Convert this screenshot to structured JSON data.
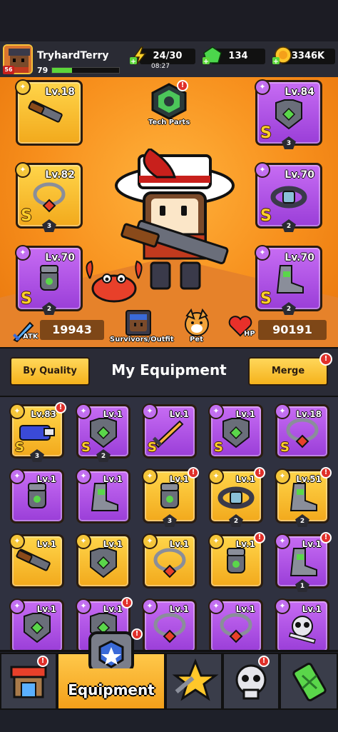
{
  "player": {
    "name": "TryhardTerry",
    "avatar_level": "56",
    "level": "79",
    "xp_fraction": 0.3
  },
  "resources": {
    "energy": "24/30",
    "energy_timer": "08:27",
    "gems": "134",
    "gold": "3346K"
  },
  "hero": {
    "tech_parts_label": "Tech Parts",
    "slots": [
      {
        "name": "weapon",
        "level": "Lv.18",
        "rarity": "",
        "stars": "",
        "quality": "gold",
        "icon": "shotgun-icon"
      },
      {
        "name": "armor",
        "level": "Lv.84",
        "rarity": "S",
        "stars": "3",
        "quality": "purple",
        "icon": "armor-icon"
      },
      {
        "name": "necklace",
        "level": "Lv.82",
        "rarity": "S",
        "stars": "3",
        "quality": "gold",
        "icon": "necklace-icon"
      },
      {
        "name": "belt",
        "level": "Lv.70",
        "rarity": "S",
        "stars": "2",
        "quality": "purple",
        "icon": "belt-icon"
      },
      {
        "name": "gloves",
        "level": "Lv.70",
        "rarity": "S",
        "stars": "2",
        "quality": "purple",
        "icon": "gloves-icon"
      },
      {
        "name": "boots",
        "level": "Lv.70",
        "rarity": "S",
        "stars": "2",
        "quality": "purple",
        "icon": "boots-icon"
      }
    ],
    "atk_label": "ATK",
    "atk_value": "19943",
    "hp_label": "HP",
    "hp_value": "90191",
    "survivors_label": "Survivors/Outfit",
    "pet_label": "Pet"
  },
  "equipment": {
    "by_quality_label": "By Quality",
    "title": "My Equipment",
    "merge_label": "Merge",
    "merge_badge": "!",
    "items": [
      {
        "level": "Lv.83",
        "rarity": "S",
        "stars": "3",
        "quality": "gold",
        "icon": "blaster-icon",
        "badge": true
      },
      {
        "level": "Lv.1",
        "rarity": "S",
        "stars": "2",
        "quality": "purple",
        "icon": "armor-icon",
        "badge": false
      },
      {
        "level": "Lv.1",
        "rarity": "S",
        "stars": "",
        "quality": "purple",
        "icon": "sword-icon",
        "badge": false
      },
      {
        "level": "Lv.1",
        "rarity": "S",
        "stars": "",
        "quality": "purple",
        "icon": "armor-icon",
        "badge": false
      },
      {
        "level": "Lv.18",
        "rarity": "S",
        "stars": "",
        "quality": "purple",
        "icon": "necklace-icon",
        "badge": false
      },
      {
        "level": "Lv.1",
        "rarity": "",
        "stars": "",
        "quality": "purple",
        "icon": "gloves-icon",
        "badge": false
      },
      {
        "level": "Lv.1",
        "rarity": "",
        "stars": "",
        "quality": "purple",
        "icon": "boots-icon",
        "badge": false
      },
      {
        "level": "Lv.1",
        "rarity": "",
        "stars": "3",
        "quality": "gold",
        "icon": "gloves-icon",
        "badge": true
      },
      {
        "level": "Lv.1",
        "rarity": "",
        "stars": "2",
        "quality": "gold",
        "icon": "belt-icon",
        "badge": true
      },
      {
        "level": "Lv.51",
        "rarity": "",
        "stars": "2",
        "quality": "gold",
        "icon": "boots-icon",
        "badge": true
      },
      {
        "level": "Lv.1",
        "rarity": "",
        "stars": "",
        "quality": "gold",
        "icon": "shotgun-icon",
        "badge": false
      },
      {
        "level": "Lv.1",
        "rarity": "",
        "stars": "",
        "quality": "gold",
        "icon": "armor-icon",
        "badge": false
      },
      {
        "level": "Lv.1",
        "rarity": "",
        "stars": "",
        "quality": "gold",
        "icon": "necklace-icon",
        "badge": false
      },
      {
        "level": "Lv.1",
        "rarity": "",
        "stars": "",
        "quality": "gold",
        "icon": "gloves-icon",
        "badge": true
      },
      {
        "level": "Lv.1",
        "rarity": "",
        "stars": "1",
        "quality": "purple",
        "icon": "boots-icon",
        "badge": true
      },
      {
        "level": "Lv.1",
        "rarity": "",
        "stars": "",
        "quality": "purple",
        "icon": "armor-icon",
        "badge": false
      },
      {
        "level": "Lv.1",
        "rarity": "",
        "stars": "",
        "quality": "purple",
        "icon": "armor-icon",
        "badge": true
      },
      {
        "level": "Lv.1",
        "rarity": "",
        "stars": "",
        "quality": "purple",
        "icon": "necklace-icon",
        "badge": false
      },
      {
        "level": "Lv.1",
        "rarity": "",
        "stars": "",
        "quality": "purple",
        "icon": "necklace-icon",
        "badge": false
      },
      {
        "level": "Lv.1",
        "rarity": "",
        "stars": "",
        "quality": "purple",
        "icon": "skull-icon",
        "badge": false
      }
    ]
  },
  "nav": {
    "active_label": "Equipment",
    "tabs": [
      "shop-icon",
      "equipment-icon",
      "star-icon",
      "skull-icon",
      "tech-icon"
    ]
  }
}
